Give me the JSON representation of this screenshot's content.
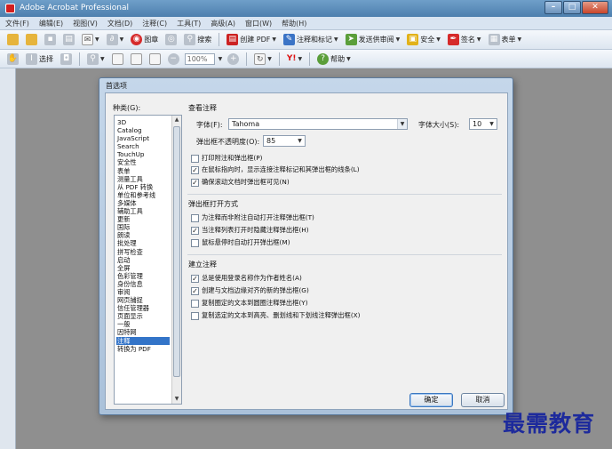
{
  "window": {
    "title": "Adobe Acrobat Professional",
    "controls": [
      "–",
      "□",
      "✕"
    ]
  },
  "menu": [
    "文件(F)",
    "编辑(E)",
    "视图(V)",
    "文档(D)",
    "注释(C)",
    "工具(T)",
    "高级(A)",
    "窗口(W)",
    "帮助(H)"
  ],
  "toolbar1": {
    "print_label": "图章",
    "search_label": "搜索",
    "create_pdf_label": "创建 PDF",
    "comment_label": "注释和标记",
    "review_label": "发送供审阅",
    "secure_label": "安全",
    "sign_label": "签名",
    "forms_label": "表单"
  },
  "toolbar2": {
    "select_label": "选择",
    "zoom_value": "100%",
    "help_label": "帮助"
  },
  "dialog": {
    "title": "首选项",
    "category_label": "种类(G):",
    "categories": [
      "3D",
      "Catalog",
      "JavaScript",
      "Search",
      "TouchUp",
      "安全性",
      "表单",
      "测量工具",
      "从 PDF 转换",
      "单位和参考线",
      "多媒体",
      "辅助工具",
      "更新",
      "国际",
      "朗读",
      "批处理",
      "拼写检查",
      "启动",
      "全屏",
      "色彩管理",
      "身份信息",
      "审阅",
      "网页捕捉",
      "信任管理器",
      "页面显示",
      "一般",
      "因特网",
      "注释",
      "转换为 PDF"
    ],
    "selected_category": "注释",
    "view_section": {
      "title": "查看注释",
      "font_label": "字体(F):",
      "font_value": "Tahoma",
      "font_size_label": "字体大小(S):",
      "font_size_value": "10",
      "opacity_label": "弹出框不透明度(O):",
      "opacity_value": "85",
      "checks": [
        {
          "label": "打印附注和弹出框(P)",
          "checked": false
        },
        {
          "label": "在鼠标指向时，显示连接注释标记和其弹出框的线条(L)",
          "checked": true
        },
        {
          "label": "确保滚动文档时弹出框可见(N)",
          "checked": true
        }
      ]
    },
    "popup_section": {
      "title": "弹出框打开方式",
      "checks": [
        {
          "label": "为注释而非附注自动打开注释弹出框(T)",
          "checked": false
        },
        {
          "label": "当注释列表打开时隐藏注释弹出框(H)",
          "checked": true
        },
        {
          "label": "鼠标悬停时自动打开弹出框(M)",
          "checked": false
        }
      ]
    },
    "create_section": {
      "title": "建立注释",
      "checks": [
        {
          "label": "总是使用登录名称作为作者姓名(A)",
          "checked": true
        },
        {
          "label": "创建与文档边缘对齐的新的弹出框(G)",
          "checked": true
        },
        {
          "label": "复制圈定的文本到圆圈注释弹出框(Y)",
          "checked": false
        },
        {
          "label": "复制选定的文本到高亮、删划线和下划线注释弹出框(X)",
          "checked": false
        }
      ]
    },
    "ok_label": "确定",
    "cancel_label": "取消"
  },
  "watermark": "最需教育"
}
